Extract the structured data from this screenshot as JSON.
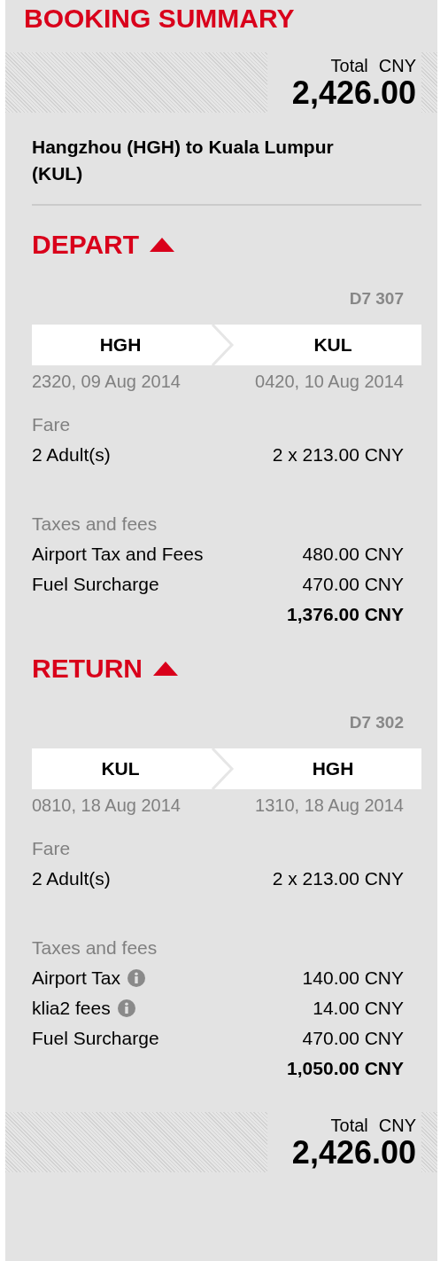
{
  "title": "BOOKING SUMMARY",
  "total_top": {
    "label": "Total",
    "currency": "CNY",
    "amount": "2,426.00"
  },
  "route": "Hangzhou (HGH) to Kuala Lumpur (KUL)",
  "sections": [
    {
      "heading": "DEPART",
      "expanded": true,
      "flight_number": "D7 307",
      "origin": {
        "code": "HGH",
        "time": "2320, 09 Aug 2014"
      },
      "destination": {
        "code": "KUL",
        "time": "0420, 10 Aug 2014"
      },
      "fare": {
        "label": "Fare",
        "rows": [
          {
            "label": "2 Adult(s)",
            "amount": "2 x 213.00 CNY",
            "info": false
          }
        ]
      },
      "taxes": {
        "label": "Taxes and fees",
        "rows": [
          {
            "label": "Airport Tax and Fees",
            "amount": "480.00 CNY",
            "info": false
          },
          {
            "label": "Fuel Surcharge",
            "amount": "470.00 CNY",
            "info": false
          }
        ]
      },
      "subtotal": "1,376.00 CNY"
    },
    {
      "heading": "RETURN",
      "expanded": true,
      "flight_number": "D7 302",
      "origin": {
        "code": "KUL",
        "time": "0810, 18 Aug 2014"
      },
      "destination": {
        "code": "HGH",
        "time": "1310, 18 Aug 2014"
      },
      "fare": {
        "label": "Fare",
        "rows": [
          {
            "label": "2 Adult(s)",
            "amount": "2 x 213.00 CNY",
            "info": false
          }
        ]
      },
      "taxes": {
        "label": "Taxes and fees",
        "rows": [
          {
            "label": "Airport Tax",
            "amount": "140.00 CNY",
            "info": true
          },
          {
            "label": "klia2 fees",
            "amount": "14.00 CNY",
            "info": true
          },
          {
            "label": "Fuel Surcharge",
            "amount": "470.00 CNY",
            "info": false
          }
        ]
      },
      "subtotal": "1,050.00 CNY"
    }
  ],
  "total_bottom": {
    "label": "Total",
    "currency": "CNY",
    "amount": "2,426.00"
  }
}
